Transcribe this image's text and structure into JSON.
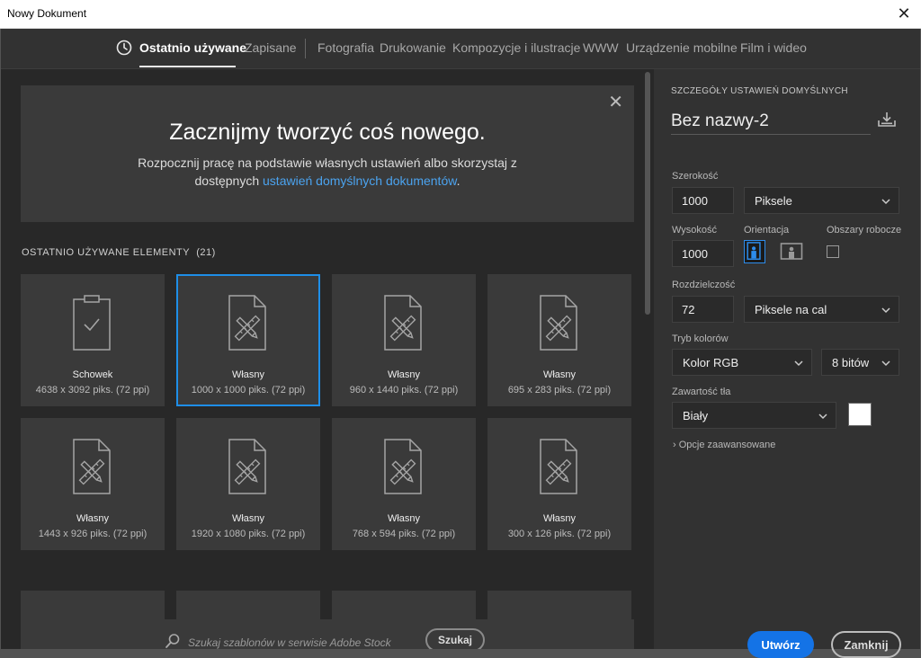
{
  "window": {
    "title": "Nowy Dokument",
    "close_glyph": "✕"
  },
  "tabs": [
    "Ostatnio używane",
    "Zapisane",
    "Fotografia",
    "Drukowanie",
    "Kompozycje i ilustracje",
    "WWW",
    "Urządzenie mobilne",
    "Film i wideo"
  ],
  "active_tab": "Ostatnio używane",
  "hero": {
    "title": "Zacznijmy tworzyć coś nowego.",
    "line1": "Rozpocznij pracę na podstawie własnych ustawień albo skorzystaj z",
    "line2_prefix": "dostępnych ",
    "line2_link": "ustawień domyślnych dokumentów",
    "line2_suffix": ".",
    "close_glyph": "✕"
  },
  "recent": {
    "title": "OSTATNIO UŻYWANE ELEMENTY",
    "count": "(21)",
    "items": [
      {
        "name": "Schowek",
        "info": "4638 x 3092 piks. (72 ppi)",
        "icon": "clipboard-icon"
      },
      {
        "name": "Własny",
        "info": "1000 x 1000 piks. (72 ppi)",
        "icon": "document-icon",
        "selected": true
      },
      {
        "name": "Własny",
        "info": "960 x 1440 piks. (72 ppi)",
        "icon": "document-icon"
      },
      {
        "name": "Własny",
        "info": "695 x 283 piks. (72 ppi)",
        "icon": "document-icon"
      },
      {
        "name": "Własny",
        "info": "1443 x 926 piks. (72 ppi)",
        "icon": "document-icon"
      },
      {
        "name": "Własny",
        "info": "1920 x 1080 piks. (72 ppi)",
        "icon": "document-icon"
      },
      {
        "name": "Własny",
        "info": "768 x 594 piks. (72 ppi)",
        "icon": "document-icon"
      },
      {
        "name": "Własny",
        "info": "300 x 126 piks. (72 ppi)",
        "icon": "document-icon"
      }
    ]
  },
  "search": {
    "placeholder": "Szukaj szablonów w serwisie Adobe Stock",
    "button": "Szukaj"
  },
  "details": {
    "heading": "SZCZEGÓŁY USTAWIEŃ DOMYŚLNYCH",
    "doc_name": "Bez nazwy-2",
    "width_label": "Szerokość",
    "width_value": "1000",
    "width_unit": "Piksele",
    "height_label": "Wysokość",
    "height_value": "1000",
    "orientation_label": "Orientacja",
    "orientation_selected": "portrait",
    "artboards_label": "Obszary robocze",
    "artboards_checked": false,
    "resolution_label": "Rozdzielczość",
    "resolution_value": "72",
    "resolution_unit": "Piksele na cal",
    "color_mode_label": "Tryb kolorów",
    "color_mode": "Kolor RGB",
    "bit_depth": "8 bitów",
    "bg_label": "Zawartość tła",
    "bg_value": "Biały",
    "bg_color": "#ffffff",
    "advanced": "Opcje zaawansowane"
  },
  "buttons": {
    "create": "Utwórz",
    "close": "Zamknij"
  },
  "colors": {
    "accent": "#1473e6",
    "selection": "#1e8ee8",
    "link": "#4ba3ef"
  }
}
